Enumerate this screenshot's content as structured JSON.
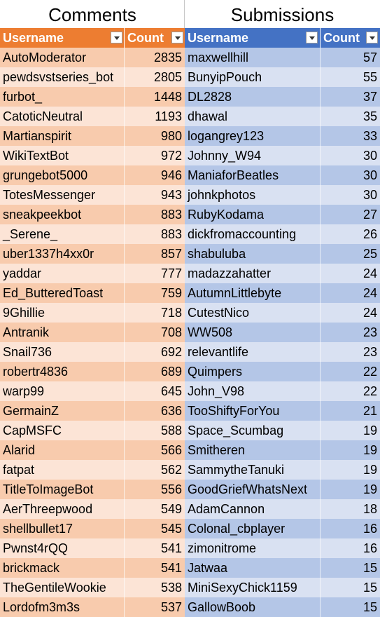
{
  "colors": {
    "orange_header": "#ED7D31",
    "orange_dark": "#F8CBAD",
    "orange_light": "#FCE4D6",
    "blue_header": "#4472C4",
    "blue_dark": "#B4C6E7",
    "blue_light": "#D9E1F2"
  },
  "comments": {
    "title": "Comments",
    "header_username": "Username",
    "header_count": "Count",
    "rows": [
      {
        "username": "AutoModerator",
        "count": "2835"
      },
      {
        "username": "pewdsvstseries_bot",
        "count": "2805"
      },
      {
        "username": "furbot_",
        "count": "1448"
      },
      {
        "username": "CatoticNeutral",
        "count": "1193"
      },
      {
        "username": "Martianspirit",
        "count": "980"
      },
      {
        "username": "WikiTextBot",
        "count": "972"
      },
      {
        "username": "grungebot5000",
        "count": "946"
      },
      {
        "username": "TotesMessenger",
        "count": "943"
      },
      {
        "username": "sneakpeekbot",
        "count": "883"
      },
      {
        "username": "_Serene_",
        "count": "883"
      },
      {
        "username": "uber1337h4xx0r",
        "count": "857"
      },
      {
        "username": "yaddar",
        "count": "777"
      },
      {
        "username": "Ed_ButteredToast",
        "count": "759"
      },
      {
        "username": "9Ghillie",
        "count": "718"
      },
      {
        "username": "Antranik",
        "count": "708"
      },
      {
        "username": "Snail736",
        "count": "692"
      },
      {
        "username": "robertr4836",
        "count": "689"
      },
      {
        "username": "warp99",
        "count": "645"
      },
      {
        "username": "GermainZ",
        "count": "636"
      },
      {
        "username": "CapMSFC",
        "count": "588"
      },
      {
        "username": "Alarid",
        "count": "566"
      },
      {
        "username": "fatpat",
        "count": "562"
      },
      {
        "username": "TitleToImageBot",
        "count": "556"
      },
      {
        "username": "AerThreepwood",
        "count": "549"
      },
      {
        "username": "shellbullet17",
        "count": "545"
      },
      {
        "username": "Pwnst4rQQ",
        "count": "541"
      },
      {
        "username": "brickmack",
        "count": "541"
      },
      {
        "username": "TheGentileWookie",
        "count": "538"
      },
      {
        "username": "Lordofm3m3s",
        "count": "537"
      }
    ]
  },
  "submissions": {
    "title": "Submissions",
    "header_username": "Username",
    "header_count": "Count",
    "rows": [
      {
        "username": "maxwellhill",
        "count": "57"
      },
      {
        "username": "BunyipPouch",
        "count": "55"
      },
      {
        "username": "DL2828",
        "count": "37"
      },
      {
        "username": "dhawal",
        "count": "35"
      },
      {
        "username": "logangrey123",
        "count": "33"
      },
      {
        "username": "Johnny_W94",
        "count": "30"
      },
      {
        "username": "ManiaforBeatles",
        "count": "30"
      },
      {
        "username": "johnkphotos",
        "count": "30"
      },
      {
        "username": "RubyKodama",
        "count": "27"
      },
      {
        "username": "dickfromaccounting",
        "count": "26"
      },
      {
        "username": "shabuluba",
        "count": "25"
      },
      {
        "username": "madazzahatter",
        "count": "24"
      },
      {
        "username": "AutumnLittlebyte",
        "count": "24"
      },
      {
        "username": "CutestNico",
        "count": "24"
      },
      {
        "username": "WW508",
        "count": "23"
      },
      {
        "username": "relevantlife",
        "count": "23"
      },
      {
        "username": "Quimpers",
        "count": "22"
      },
      {
        "username": "John_V98",
        "count": "22"
      },
      {
        "username": "TooShiftyForYou",
        "count": "21"
      },
      {
        "username": "Space_Scumbag",
        "count": "19"
      },
      {
        "username": "Smitheren",
        "count": "19"
      },
      {
        "username": "SammytheTanuki",
        "count": "19"
      },
      {
        "username": "GoodGriefWhatsNext",
        "count": "19"
      },
      {
        "username": "AdamCannon",
        "count": "18"
      },
      {
        "username": "Colonal_cbplayer",
        "count": "16"
      },
      {
        "username": "zimonitrome",
        "count": "16"
      },
      {
        "username": "Jatwaa",
        "count": "15"
      },
      {
        "username": "MiniSexyChick1159",
        "count": "15"
      },
      {
        "username": "GallowBoob",
        "count": "15"
      }
    ]
  }
}
